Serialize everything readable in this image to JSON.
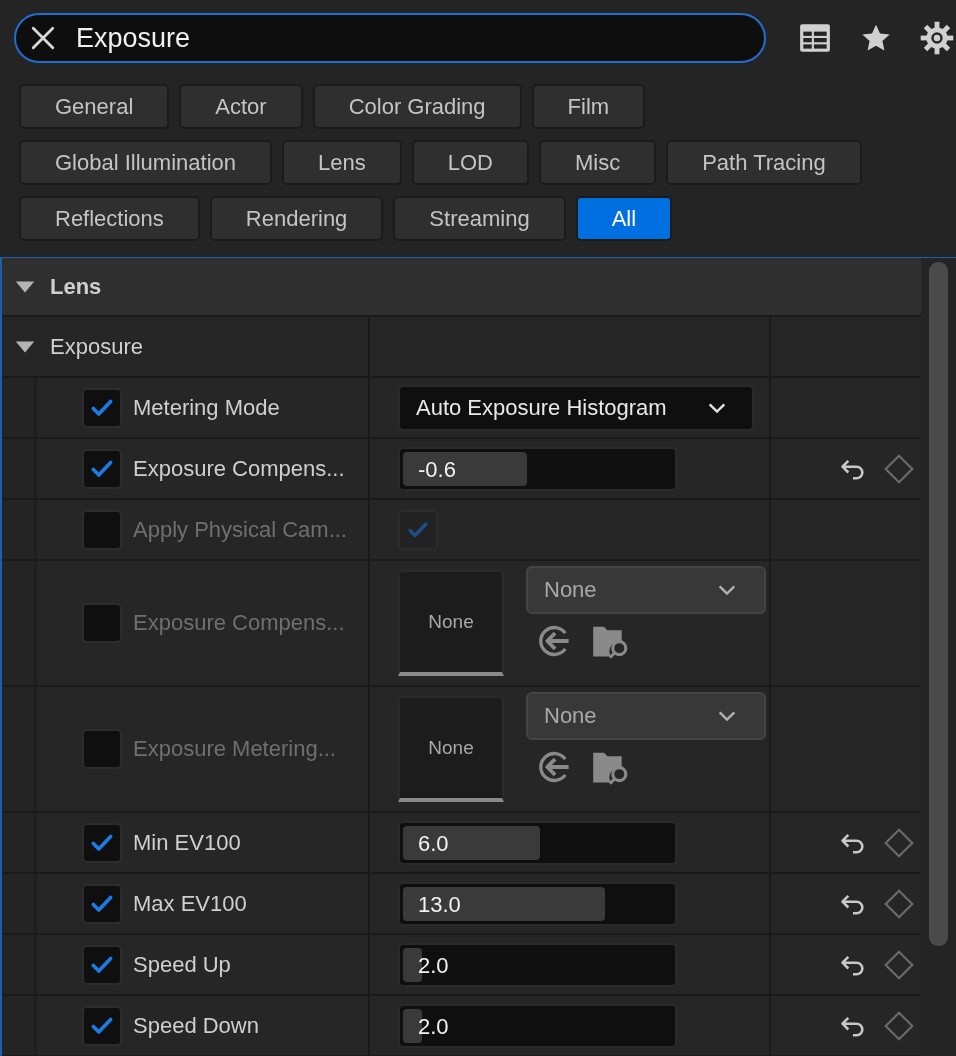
{
  "search": {
    "value": "Exposure"
  },
  "filters": [
    {
      "label": "General",
      "selected": false
    },
    {
      "label": "Actor",
      "selected": false
    },
    {
      "label": "Color Grading",
      "selected": false
    },
    {
      "label": "Film",
      "selected": false
    },
    {
      "label": "Global Illumination",
      "selected": false
    },
    {
      "label": "Lens",
      "selected": false
    },
    {
      "label": "LOD",
      "selected": false
    },
    {
      "label": "Misc",
      "selected": false
    },
    {
      "label": "Path Tracing",
      "selected": false
    },
    {
      "label": "Reflections",
      "selected": false
    },
    {
      "label": "Rendering",
      "selected": false
    },
    {
      "label": "Streaming",
      "selected": false
    },
    {
      "label": "All",
      "selected": true
    }
  ],
  "category": {
    "label": "Lens",
    "expanded": true
  },
  "group": {
    "label": "Exposure",
    "expanded": true
  },
  "properties": [
    {
      "label": "Metering Mode",
      "checked": true,
      "kind": "dropdown",
      "value": "Auto Exposure Histogram",
      "modified": false
    },
    {
      "label": "Exposure Compens...",
      "checked": true,
      "kind": "number",
      "value": "-0.6",
      "level": 0.46,
      "modified": true
    },
    {
      "label": "Apply Physical Cam...",
      "checked": false,
      "kind": "checkbox",
      "value_checked": true,
      "modified": false
    },
    {
      "label": "Exposure Compens...",
      "checked": false,
      "kind": "asset",
      "thumb": "None",
      "value": "None",
      "modified": false
    },
    {
      "label": "Exposure Metering...",
      "checked": false,
      "kind": "asset",
      "thumb": "None",
      "value": "None",
      "modified": false
    },
    {
      "label": "Min EV100",
      "checked": true,
      "kind": "number",
      "value": "6.0",
      "level": 0.51,
      "modified": true
    },
    {
      "label": "Max EV100",
      "checked": true,
      "kind": "number",
      "value": "13.0",
      "level": 0.75,
      "modified": true
    },
    {
      "label": "Speed Up",
      "checked": true,
      "kind": "number",
      "value": "2.0",
      "level": 0.07,
      "modified": true
    },
    {
      "label": "Speed Down",
      "checked": true,
      "kind": "number",
      "value": "2.0",
      "level": 0.07,
      "modified": true
    }
  ]
}
